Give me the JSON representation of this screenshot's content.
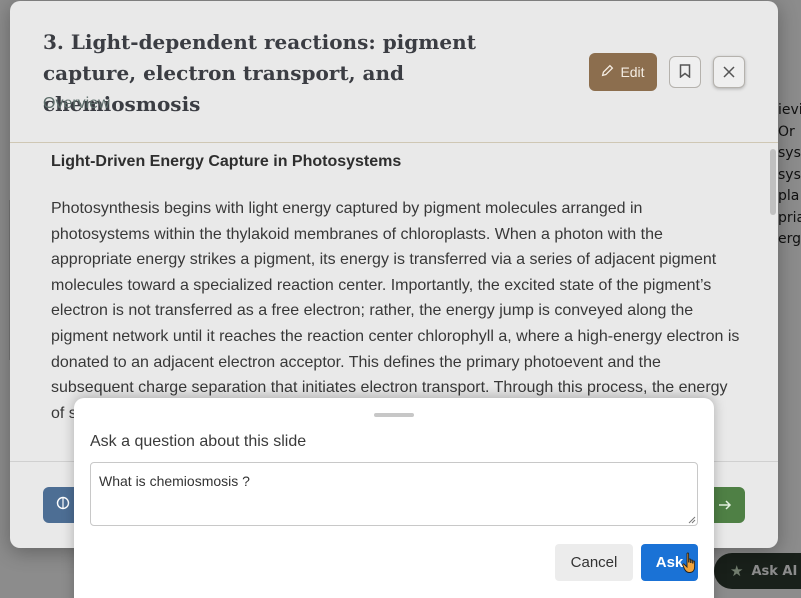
{
  "background": {
    "right_col_lines": [
      "ievi",
      "",
      "Or",
      "sys",
      "sys",
      "",
      "pla",
      "pria",
      "erg"
    ],
    "ask_ai_label": "Ask AI"
  },
  "modal": {
    "title": "3. Light-dependent reactions: pigment capture, electron transport, and chemiosmosis",
    "subtitle": "Overview",
    "edit_label": "Edit"
  },
  "content": {
    "heading": "Light-Driven Energy Capture in Photosystems",
    "body": "Photosynthesis begins with light energy captured by pigment molecules arranged in photosystems within the thylakoid membranes of chloroplasts. When a photon with the appropriate energy strikes a pigment, its energy is transferred via a series of adjacent pigment molecules toward a specialized reaction center. Importantly, the excited state of the pigment’s electron is not transferred as a free electron; rather, the energy jump is conveyed along the pigment network until it reaches the reaction center chlorophyll a, where a high-energy electron is donated to an adjacent electron acceptor. This defines the primary photoevent and the subsequent charge separation that initiates electron transport. Through this process, the energy of sunlight is harnessed and converted into chemical energy."
  },
  "sheet": {
    "title": "Ask a question about this slide",
    "input_value": "What is chemiosmosis ?",
    "cancel_label": "Cancel",
    "ask_label": "Ask"
  }
}
